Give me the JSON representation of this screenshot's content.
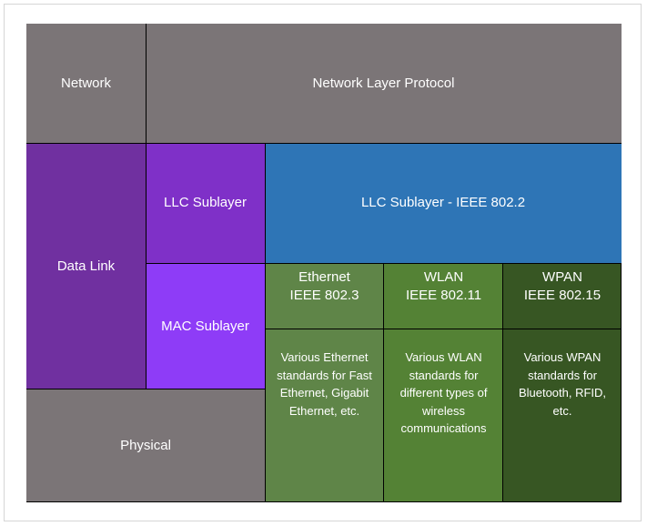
{
  "layers": {
    "network": "Network",
    "network_protocol": "Network Layer Protocol",
    "datalink": "Data Link",
    "llc_sublayer": "LLC Sublayer",
    "llc_ieee": "LLC Sublayer - IEEE 802.2",
    "mac_sublayer": "MAC Sublayer",
    "physical": "Physical"
  },
  "standards": [
    {
      "name": "Ethernet",
      "ieee": "IEEE 802.3",
      "description": "Various Ethernet standards for Fast Ethernet, Gigabit Ethernet, etc."
    },
    {
      "name": "WLAN",
      "ieee": "IEEE 802.11",
      "description": "Various WLAN standards for different types of wireless communications"
    },
    {
      "name": "WPAN",
      "ieee": "IEEE 802.15",
      "description": "Various WPAN standards for Bluetooth, RFID, etc."
    }
  ],
  "colors": {
    "gray": "#7b7577",
    "datalink": "#7030a0",
    "llc": "#7f30c8",
    "mac": "#8e3cf7",
    "llc_ieee": "#2e75b6",
    "ethernet": "#5f8548",
    "wlan": "#548235",
    "wpan": "#375623"
  }
}
